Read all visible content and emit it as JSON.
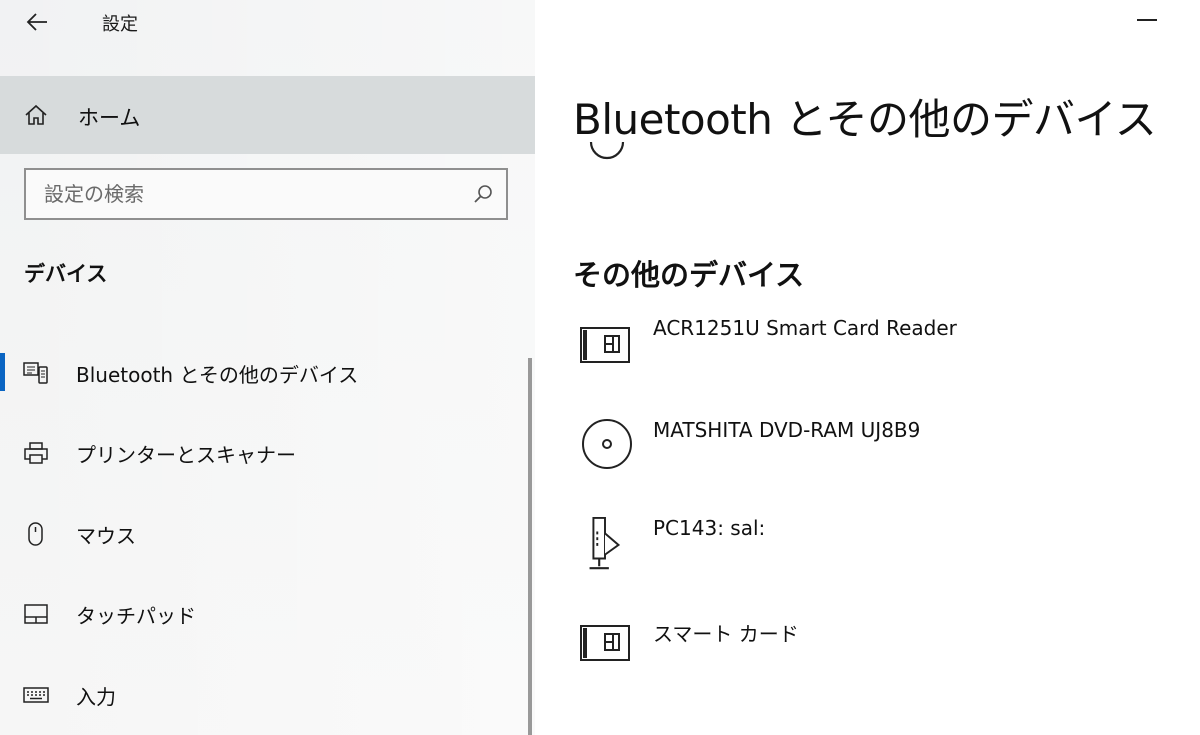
{
  "window": {
    "app_title": "設定"
  },
  "sidebar": {
    "home_label": "ホーム",
    "search_placeholder": "設定の検索",
    "section_heading": "デバイス",
    "items": [
      {
        "label": "Bluetooth とその他のデバイス",
        "icon": "bluetooth-devices-icon",
        "selected": true
      },
      {
        "label": "プリンターとスキャナー",
        "icon": "printer-icon",
        "selected": false
      },
      {
        "label": "マウス",
        "icon": "mouse-icon",
        "selected": false
      },
      {
        "label": "タッチパッド",
        "icon": "touchpad-icon",
        "selected": false
      },
      {
        "label": "入力",
        "icon": "keyboard-icon",
        "selected": false
      }
    ]
  },
  "main": {
    "title": "Bluetooth とその他のデバイス",
    "section_heading": "その他のデバイス",
    "devices": [
      {
        "name": "ACR1251U Smart Card Reader",
        "icon": "smart-card-reader-icon"
      },
      {
        "name": "MATSHITA DVD-RAM UJ8B9",
        "icon": "optical-drive-icon"
      },
      {
        "name": "PC143: sal:",
        "icon": "media-device-icon"
      },
      {
        "name": "スマート カード",
        "icon": "smart-card-icon"
      }
    ]
  },
  "colors": {
    "accent": "#0a64c2",
    "sidebar_bg": "#f2f3f3",
    "home_highlight": "#d7dbdc"
  }
}
